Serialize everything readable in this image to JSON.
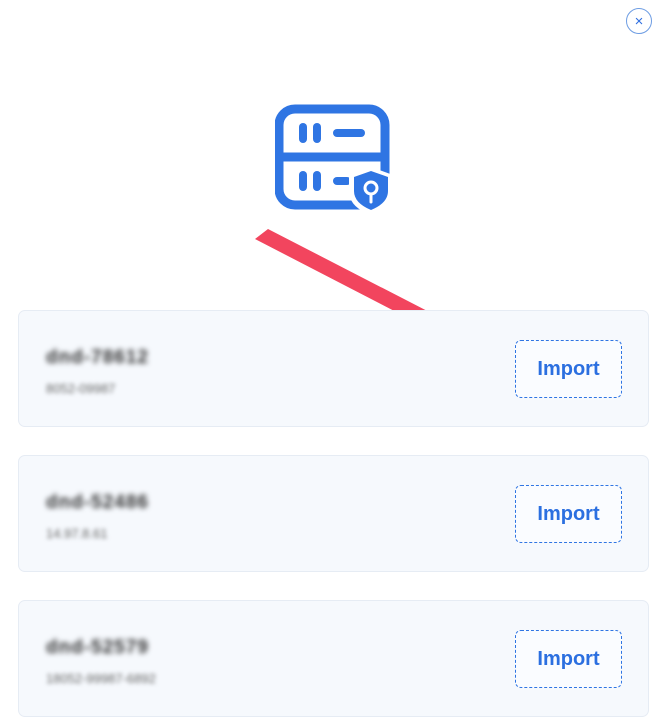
{
  "dialog": {
    "close_symbol": "×",
    "hero_icon": "server-shield-icon"
  },
  "accounts": [
    {
      "name": "dnd-78612",
      "sub": "8052-09987",
      "import_label": "Import"
    },
    {
      "name": "dnd-52486",
      "sub": "14.97.8.61",
      "import_label": "Import"
    },
    {
      "name": "dnd-52579",
      "sub": "18052-99987-6892",
      "import_label": "Import"
    }
  ],
  "colors": {
    "accent": "#2F75E3",
    "arrow": "#F2455E",
    "card_bg": "#F6F9FD"
  }
}
